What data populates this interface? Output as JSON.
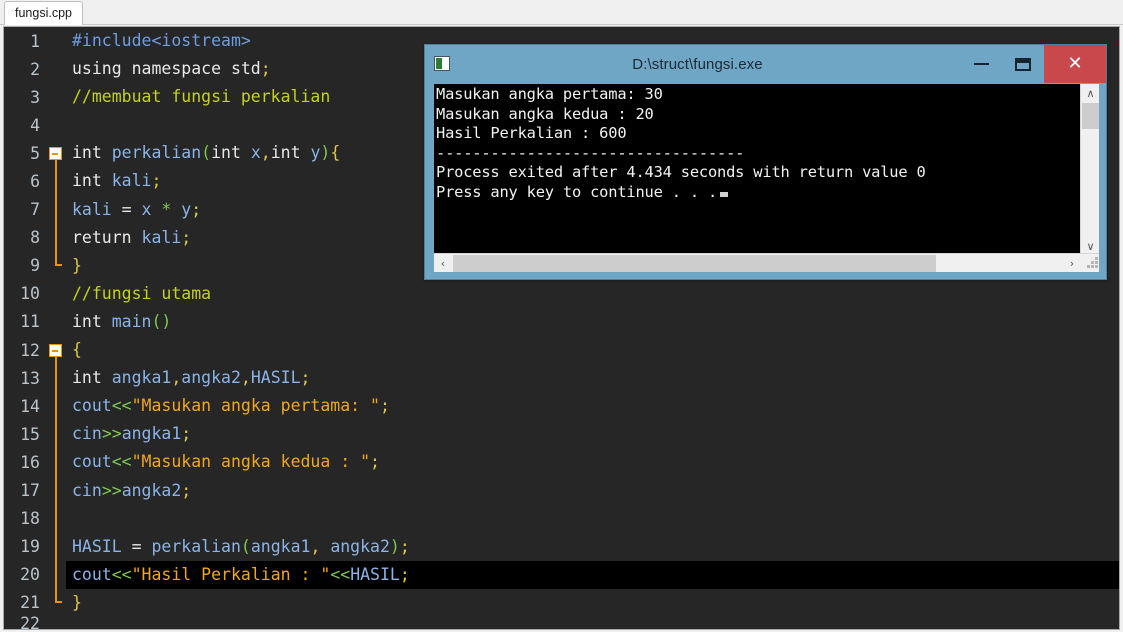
{
  "ide": {
    "tab_label": "fungsi.cpp",
    "current_line": 20,
    "code_lines": [
      {
        "n": "1",
        "fold": "none",
        "segments": [
          {
            "t": "#include",
            "c": "k-pre"
          },
          {
            "t": "<iostream>",
            "c": "k-pre"
          }
        ]
      },
      {
        "n": "2",
        "fold": "none",
        "segments": [
          {
            "t": "using namespace std",
            "c": "k-pln"
          },
          {
            "t": ";",
            "c": "k-pun"
          }
        ]
      },
      {
        "n": "3",
        "fold": "none",
        "segments": [
          {
            "t": "//membuat fungsi perkalian",
            "c": "k-cmt"
          }
        ]
      },
      {
        "n": "4",
        "fold": "none",
        "segments": []
      },
      {
        "n": "5",
        "fold": "box",
        "segments": [
          {
            "t": "int ",
            "c": "k-pln"
          },
          {
            "t": "perkalian",
            "c": "k-id"
          },
          {
            "t": "(",
            "c": "k-op"
          },
          {
            "t": "int ",
            "c": "k-pln"
          },
          {
            "t": "x",
            "c": "k-id"
          },
          {
            "t": ",",
            "c": "k-pun"
          },
          {
            "t": "int ",
            "c": "k-pln"
          },
          {
            "t": "y",
            "c": "k-id"
          },
          {
            "t": ")",
            "c": "k-op"
          },
          {
            "t": "{",
            "c": "k-pun"
          }
        ]
      },
      {
        "n": "6",
        "fold": "line",
        "segments": [
          {
            "t": "int ",
            "c": "k-pln"
          },
          {
            "t": "kali",
            "c": "k-id"
          },
          {
            "t": ";",
            "c": "k-pun"
          }
        ]
      },
      {
        "n": "7",
        "fold": "line",
        "segments": [
          {
            "t": "kali ",
            "c": "k-id"
          },
          {
            "t": "= ",
            "c": "k-pln"
          },
          {
            "t": "x ",
            "c": "k-id"
          },
          {
            "t": "* ",
            "c": "k-op"
          },
          {
            "t": "y",
            "c": "k-id"
          },
          {
            "t": ";",
            "c": "k-pun"
          }
        ]
      },
      {
        "n": "8",
        "fold": "line",
        "segments": [
          {
            "t": "return ",
            "c": "k-pln"
          },
          {
            "t": "kali",
            "c": "k-id"
          },
          {
            "t": ";",
            "c": "k-pun"
          }
        ]
      },
      {
        "n": "9",
        "fold": "end",
        "segments": [
          {
            "t": "}",
            "c": "k-pun"
          }
        ]
      },
      {
        "n": "10",
        "fold": "none",
        "segments": [
          {
            "t": "//fungsi utama",
            "c": "k-cmt"
          }
        ]
      },
      {
        "n": "11",
        "fold": "none",
        "segments": [
          {
            "t": "int ",
            "c": "k-pln"
          },
          {
            "t": "main",
            "c": "k-id"
          },
          {
            "t": "()",
            "c": "k-op"
          }
        ]
      },
      {
        "n": "12",
        "fold": "box",
        "segments": [
          {
            "t": "{",
            "c": "k-pun"
          }
        ]
      },
      {
        "n": "13",
        "fold": "line",
        "segments": [
          {
            "t": "int ",
            "c": "k-pln"
          },
          {
            "t": "angka1",
            "c": "k-id"
          },
          {
            "t": ",",
            "c": "k-pun"
          },
          {
            "t": "angka2",
            "c": "k-id"
          },
          {
            "t": ",",
            "c": "k-pun"
          },
          {
            "t": "HASIL",
            "c": "k-id"
          },
          {
            "t": ";",
            "c": "k-pun"
          }
        ]
      },
      {
        "n": "14",
        "fold": "line",
        "segments": [
          {
            "t": "cout",
            "c": "k-id"
          },
          {
            "t": "<<",
            "c": "k-op"
          },
          {
            "t": "\"Masukan angka pertama: \"",
            "c": "k-str"
          },
          {
            "t": ";",
            "c": "k-pun"
          }
        ]
      },
      {
        "n": "15",
        "fold": "line",
        "segments": [
          {
            "t": "cin",
            "c": "k-id"
          },
          {
            "t": ">>",
            "c": "k-op"
          },
          {
            "t": "angka1",
            "c": "k-id"
          },
          {
            "t": ";",
            "c": "k-pun"
          }
        ]
      },
      {
        "n": "16",
        "fold": "line",
        "segments": [
          {
            "t": "cout",
            "c": "k-id"
          },
          {
            "t": "<<",
            "c": "k-op"
          },
          {
            "t": "\"Masukan angka kedua : \"",
            "c": "k-str"
          },
          {
            "t": ";",
            "c": "k-pun"
          }
        ]
      },
      {
        "n": "17",
        "fold": "line",
        "segments": [
          {
            "t": "cin",
            "c": "k-id"
          },
          {
            "t": ">>",
            "c": "k-op"
          },
          {
            "t": "angka2",
            "c": "k-id"
          },
          {
            "t": ";",
            "c": "k-pun"
          }
        ]
      },
      {
        "n": "18",
        "fold": "line",
        "segments": []
      },
      {
        "n": "19",
        "fold": "line",
        "segments": [
          {
            "t": "HASIL ",
            "c": "k-id"
          },
          {
            "t": "= ",
            "c": "k-pln"
          },
          {
            "t": "perkalian",
            "c": "k-id"
          },
          {
            "t": "(",
            "c": "k-op"
          },
          {
            "t": "angka1",
            "c": "k-id"
          },
          {
            "t": ", ",
            "c": "k-pun"
          },
          {
            "t": "angka2",
            "c": "k-id"
          },
          {
            "t": ")",
            "c": "k-op"
          },
          {
            "t": ";",
            "c": "k-pun"
          }
        ]
      },
      {
        "n": "20",
        "fold": "line",
        "current": true,
        "segments": [
          {
            "t": "cout",
            "c": "k-id"
          },
          {
            "t": "<<",
            "c": "k-op"
          },
          {
            "t": "\"Hasil Perkalian : \"",
            "c": "k-str"
          },
          {
            "t": "<<",
            "c": "k-op"
          },
          {
            "t": "HASIL",
            "c": "k-id"
          },
          {
            "t": ";",
            "c": "k-pun"
          }
        ]
      },
      {
        "n": "21",
        "fold": "end",
        "segments": [
          {
            "t": "}",
            "c": "k-pun"
          }
        ]
      },
      {
        "n": "22",
        "fold": "none",
        "clipped": true,
        "segments": []
      }
    ]
  },
  "console": {
    "title": "D:\\struct\\fungsi.exe",
    "sys_icon": "console-app-icon",
    "minimize_label": "—",
    "maximize_label": "□",
    "close_label": "×",
    "output_lines": [
      "Masukan angka pertama: 30",
      "Masukan angka kedua : 20",
      "Hasil Perkalian : 600",
      "----------------------------------",
      "Process exited after 4.434 seconds with return value 0",
      "Press any key to continue . . ."
    ],
    "scroll_up_glyph": "∧",
    "scroll_down_glyph": "∨",
    "scroll_left_glyph": "‹",
    "scroll_right_glyph": "›"
  },
  "colors": {
    "editor_bg": "#262626",
    "console_frame": "#6fa6c6",
    "close_button": "#c9484b",
    "fold_marker": "#e8930c",
    "string": "#f0a818",
    "comment": "#c5d11c",
    "identifier": "#8ab4e8",
    "operator": "#7ec94f"
  }
}
